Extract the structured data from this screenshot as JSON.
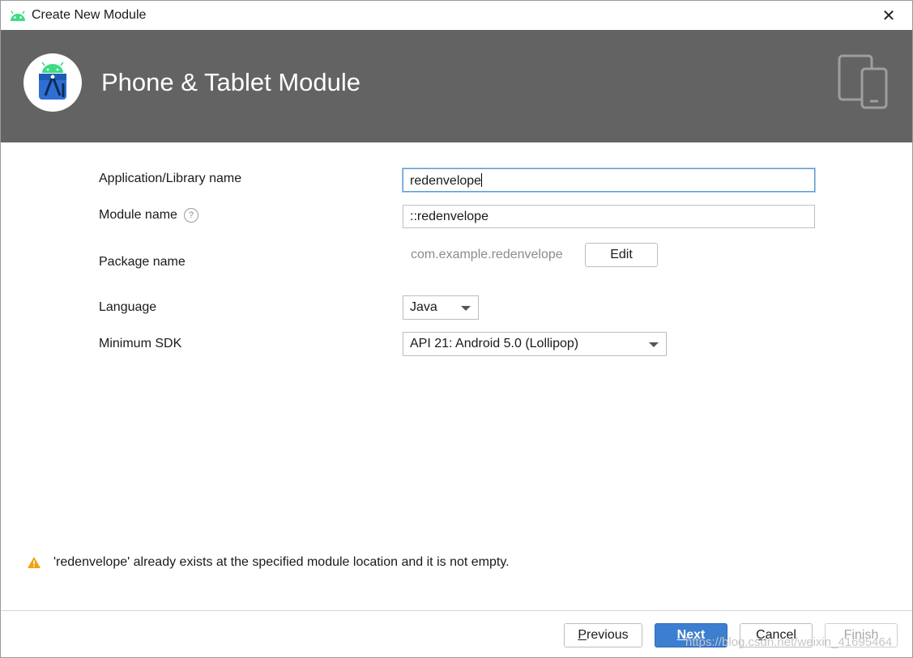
{
  "window": {
    "title": "Create New Module",
    "close_glyph": "✕",
    "app_icon": "android-icon"
  },
  "banner": {
    "heading": "Phone & Tablet Module",
    "logo_icon": "android-studio-logo-icon",
    "device_icon": "phone-tablet-icon",
    "background": "#636363"
  },
  "form": {
    "app_name": {
      "label": "Application/Library name",
      "value": "redenvelope"
    },
    "module_name": {
      "label": "Module name",
      "value": "::redenvelope",
      "help_glyph": "?"
    },
    "package_name": {
      "label": "Package name",
      "value": "com.example.redenvelope",
      "edit_label": "Edit"
    },
    "language": {
      "label": "Language",
      "selected": "Java"
    },
    "min_sdk": {
      "label": "Minimum SDK",
      "selected": "API 21: Android 5.0 (Lollipop)"
    }
  },
  "warning": {
    "icon": "warning-triangle-icon",
    "text": "'redenvelope' already exists at the specified module location and it is not empty."
  },
  "footer": {
    "previous": {
      "mnemonic": "P",
      "rest": "revious"
    },
    "next": {
      "mnemonic": "N",
      "rest": "ext"
    },
    "cancel": {
      "mnemonic": "C",
      "rest": "ancel"
    },
    "finish": {
      "label": "Finish"
    }
  },
  "watermark": "https://blog.csdn.net/weixin_41695464",
  "colors": {
    "accent": "#3c7fd0",
    "warning": "#f0a30a",
    "focus_border": "#5b9bd5"
  }
}
